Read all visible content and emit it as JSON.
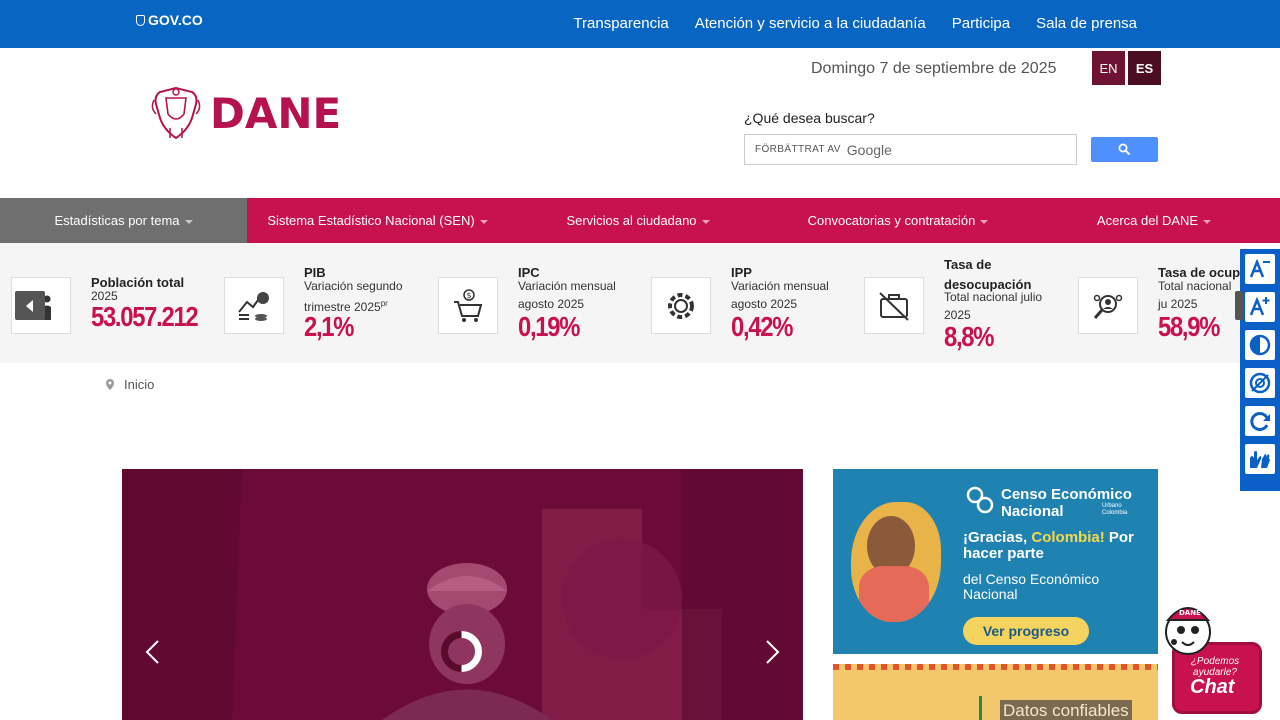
{
  "gov": {
    "logo": "GOV.CO",
    "links": [
      "Transparencia",
      "Atención y servicio a la ciudadanía",
      "Participa",
      "Sala de prensa"
    ]
  },
  "header": {
    "logo_text": "DANE",
    "date": "Domingo 7 de septiembre de 2025",
    "lang_en": "EN",
    "lang_es": "ES",
    "search_label": "¿Qué desea buscar?",
    "search_powered": "FÖRBÄTTRAT AV",
    "search_google": "Google"
  },
  "nav": [
    "Estadísticas por tema",
    "Sistema Estadístico Nacional (SEN)",
    "Servicios al ciudadano",
    "Convocatorias y contratación",
    "Acerca del DANE"
  ],
  "indicators": [
    {
      "title": "Población total",
      "sub": "2025",
      "value": "53.057.212",
      "icon": "people-icon"
    },
    {
      "title": "PIB",
      "sub": "Variación segundo trimestre 2025",
      "sup": "pr",
      "value": "2,1%",
      "icon": "growth-chart-icon"
    },
    {
      "title": "IPC",
      "sub": "Variación mensual agosto 2025",
      "value": "0,19%",
      "icon": "shopping-cart-icon"
    },
    {
      "title": "IPP",
      "sub": "Variación mensual agosto 2025",
      "value": "0,42%",
      "icon": "gear-icon"
    },
    {
      "title": "Tasa de desocupación",
      "sub": "Total nacional julio 2025",
      "value": "8,8%",
      "icon": "briefcase-off-icon"
    },
    {
      "title": "Tasa de ocupa",
      "sub": "Total nacional ju 2025",
      "value": "58,9%",
      "icon": "person-search-icon"
    }
  ],
  "breadcrumb": {
    "home": "Inicio"
  },
  "banner": {
    "title": "Censo Económico Nacional",
    "small": "Urbano Colombia",
    "headline_pre": "¡Gracias, ",
    "headline_hl": "Colombia!",
    "headline_post": " Por hacer parte",
    "text": "del Censo Económico Nacional",
    "button": "Ver progreso"
  },
  "banner2": {
    "tag": "Datos confiables"
  },
  "chat": {
    "question": "¿Podemos ayudarle?",
    "label": "Chat"
  },
  "a11y": [
    "decrease-font-icon",
    "increase-font-icon",
    "contrast-icon",
    "relief-icon",
    "reset-icon",
    "sign-language-icon"
  ]
}
